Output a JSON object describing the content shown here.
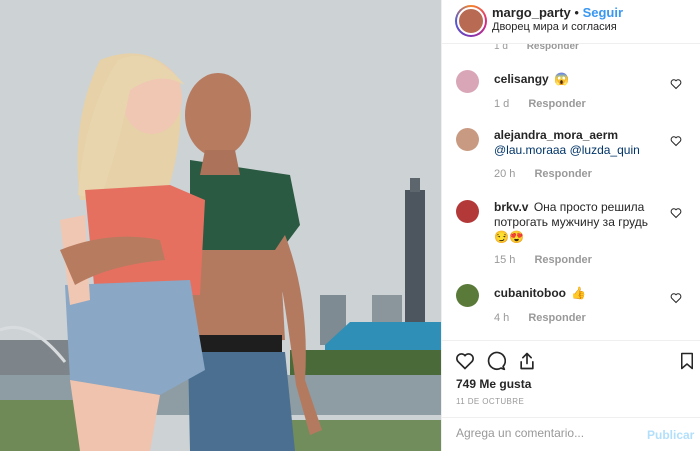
{
  "post": {
    "username": "margo_party",
    "separator": "•",
    "follow_label": "Seguir",
    "location": "Дворец мира и согласия"
  },
  "comments_top": {
    "time": "1 d",
    "reply": "Responder"
  },
  "comments": [
    {
      "user": "celisangy",
      "text": "😱",
      "time": "1 d",
      "reply": "Responder",
      "avatar_color": "#d8a6b6"
    },
    {
      "user": "alejandra_mora_aerm",
      "mention1": "@lau.moraaa",
      "mention2": "@luzda_quin",
      "time": "20 h",
      "reply": "Responder",
      "avatar_color": "#c99a82"
    },
    {
      "user": "brkv.v",
      "text": "Она просто решила потрогать мужчину за грудь",
      "emojis": "😏😍",
      "time": "15 h",
      "reply": "Responder",
      "avatar_color": "#b33939"
    },
    {
      "user": "cubanitoboo",
      "text": "👍",
      "time": "4 h",
      "reply": "Responder",
      "avatar_color": "#5a7a3a"
    }
  ],
  "actions": {
    "likes": "749 Me gusta",
    "date": "11 DE OCTUBRE"
  },
  "add_comment": {
    "placeholder": "Agrega un comentario...",
    "post_label": "Publicar"
  },
  "icons": {
    "like": "heart-icon",
    "comment": "comment-icon",
    "share": "share-icon",
    "save": "bookmark-icon",
    "comment_like": "heart-icon"
  },
  "colors": {
    "accent": "#3897f0",
    "muted": "#999999",
    "post_disabled": "#b2dffc"
  }
}
